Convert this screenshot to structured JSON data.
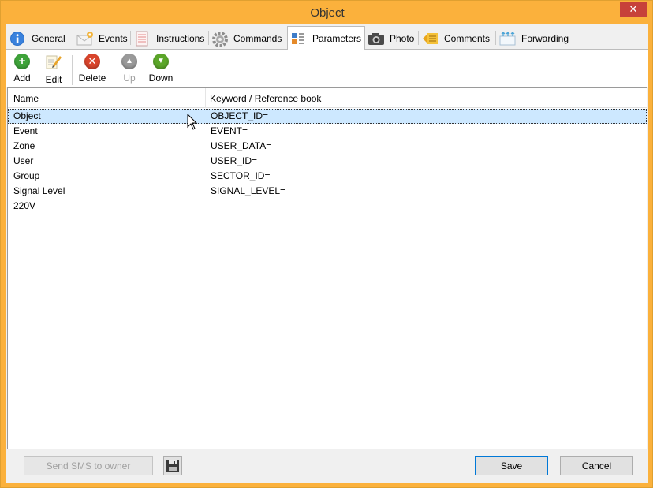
{
  "window": {
    "title": "Object",
    "close_glyph": "✕"
  },
  "tabs": [
    {
      "label": "General",
      "icon": "info-icon"
    },
    {
      "label": "Events",
      "icon": "envelope-icon"
    },
    {
      "label": "Instructions",
      "icon": "notepad-icon"
    },
    {
      "label": "Commands",
      "icon": "gear-icon"
    },
    {
      "label": "Parameters",
      "icon": "parameters-icon",
      "active": true
    },
    {
      "label": "Photo",
      "icon": "camera-icon"
    },
    {
      "label": "Comments",
      "icon": "comment-icon"
    },
    {
      "label": "Forwarding",
      "icon": "forwarding-icon"
    }
  ],
  "toolbar": {
    "add_label": "Add",
    "edit_label": "Edit",
    "delete_label": "Delete",
    "up_label": "Up",
    "down_label": "Down"
  },
  "grid": {
    "columns": [
      "Name",
      "Keyword / Reference book"
    ],
    "rows": [
      {
        "name": "Object",
        "keyword": "OBJECT_ID="
      },
      {
        "name": "Event",
        "keyword": "EVENT="
      },
      {
        "name": "Zone",
        "keyword": "USER_DATA="
      },
      {
        "name": "User",
        "keyword": "USER_ID="
      },
      {
        "name": "Group",
        "keyword": "SECTOR_ID="
      },
      {
        "name": "Signal Level",
        "keyword": "SIGNAL_LEVEL="
      },
      {
        "name": "220V",
        "keyword": ""
      }
    ]
  },
  "footer": {
    "send_sms_label": "Send SMS to owner",
    "save_label": "Save",
    "cancel_label": "Cancel"
  },
  "colors": {
    "title_bar": "#fbb13c",
    "selection": "#cde8ff",
    "add_green": "#3ea33a",
    "delete_red": "#d9452c",
    "down_green": "#5ba629",
    "up_gray": "#9a9a9a"
  }
}
